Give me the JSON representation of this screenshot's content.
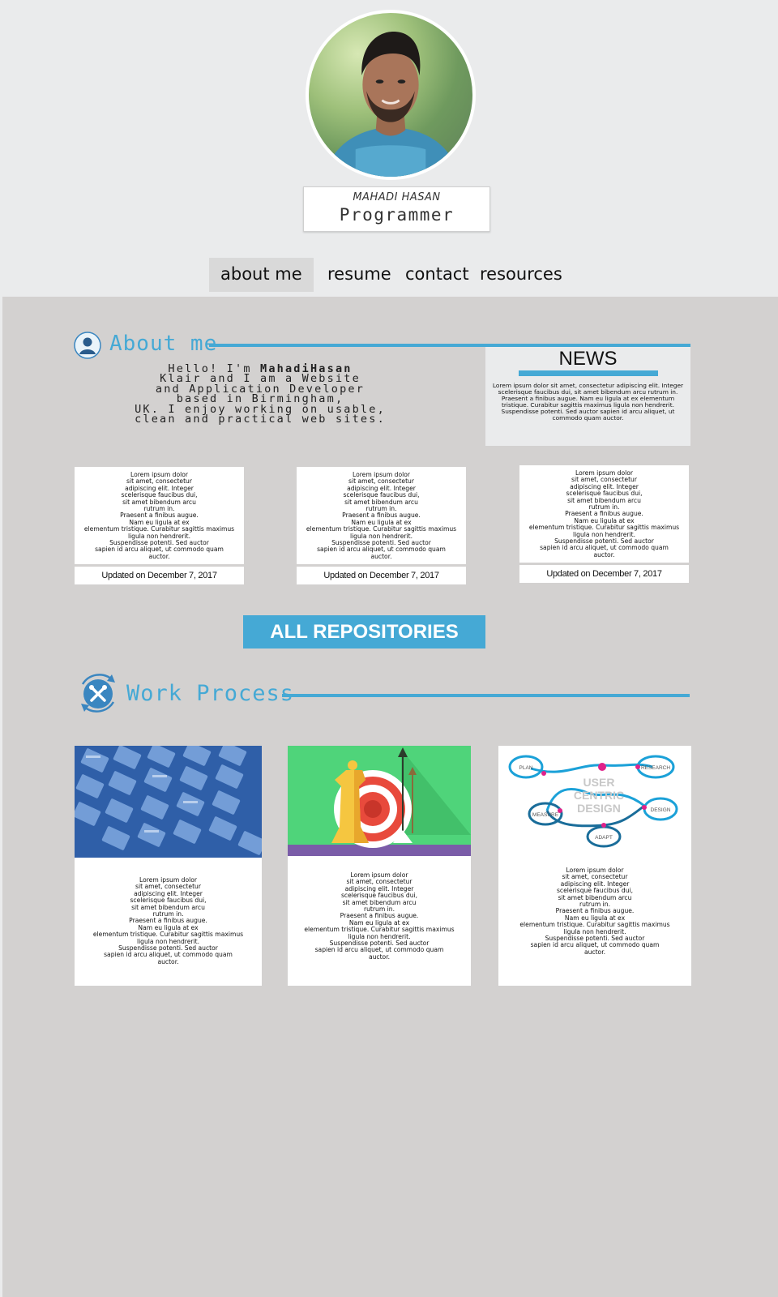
{
  "profile": {
    "name": "MAHADI HASAN",
    "role": "Programmer"
  },
  "nav": {
    "items": [
      {
        "label": "about me",
        "active": true
      },
      {
        "label": "resume",
        "active": false
      },
      {
        "label": "contact",
        "active": false
      },
      {
        "label": "resources",
        "active": false
      }
    ]
  },
  "about": {
    "title": "About me",
    "intro_before": "Hello! I'm ",
    "intro_name": "MahadiHasan",
    "intro_after": "\nKlair and I am a Website\nand Application Developer\nbased in Birmingham,\nUK. I enjoy working on usable,\nclean and practical web sites."
  },
  "news": {
    "title": "NEWS",
    "body": "Lorem ipsum dolor sit amet, consectetur adipiscing elit. Integer scelerisque faucibus dui, sit amet bibendum arcu rutrum in. Praesent a finibus augue. Nam eu ligula at ex elementum tristique. Curabitur sagittis maximus ligula non hendrerit. Suspendisse potenti. Sed auctor sapien id arcu aliquet, ut commodo quam auctor."
  },
  "repo_cards": [
    {
      "text": "Lorem ipsum dolor\nsit amet, consectetur\nadipiscing elit. Integer\nscelerisque faucibus dui,\nsit amet bibendum arcu\nrutrum in.\nPraesent a finibus augue.\nNam eu ligula at ex\nelementum tristique. Curabitur sagittis maximus\nligula non hendrerit.\nSuspendisse potenti. Sed auctor\nsapien id arcu aliquet, ut commodo quam\nauctor.",
      "updated": "Updated on December 7, 2017"
    },
    {
      "text": "Lorem ipsum dolor\nsit amet, consectetur\nadipiscing elit. Integer\nscelerisque faucibus dui,\nsit amet bibendum arcu\nrutrum in.\nPraesent a finibus augue.\nNam eu ligula at ex\nelementum tristique. Curabitur sagittis maximus\nligula non hendrerit.\nSuspendisse potenti. Sed auctor\nsapien id arcu aliquet, ut commodo quam\nauctor.",
      "updated": "Updated on December 7, 2017"
    },
    {
      "text": "Lorem ipsum dolor\nsit amet, consectetur\nadipiscing elit. Integer\nscelerisque faucibus dui,\nsit amet bibendum arcu\nrutrum in.\nPraesent a finibus augue.\nNam eu ligula at ex\nelementum tristique. Curabitur sagittis maximus\nligula non hendrerit.\nSuspendisse potenti. Sed auctor\nsapien id arcu aliquet, ut commodo quam\nauctor.",
      "updated": "Updated on December 7, 2017"
    }
  ],
  "all_repos_label": "ALL REPOSITORIES",
  "work": {
    "title": "Work Process",
    "cards": [
      {
        "image": "wireframe-grid",
        "text": "Lorem ipsum dolor\nsit amet, consectetur\nadipiscing elit. Integer\nscelerisque faucibus dui,\nsit amet bibendum arcu\nrutrum in.\nPraesent a finibus augue.\nNam eu ligula at ex\nelementum tristique. Curabitur sagittis maximus\nligula non hendrerit.\nSuspendisse potenti. Sed auctor\nsapien id arcu aliquet, ut commodo quam\nauctor."
      },
      {
        "image": "strategy-target",
        "text": "Lorem ipsum dolor\nsit amet, consectetur\nadipiscing elit. Integer\nscelerisque faucibus dui,\nsit amet bibendum arcu\nrutrum in.\nPraesent a finibus augue.\nNam eu ligula at ex\nelementum tristique. Curabitur sagittis maximus\nligula non hendrerit.\nSuspendisse potenti. Sed auctor\nsapien id arcu aliquet, ut commodo quam\nauctor."
      },
      {
        "image": "user-centric-design",
        "diagram_labels": {
          "center": [
            "USER",
            "CENTRIC",
            "DESIGN"
          ],
          "nodes": [
            "PLAN",
            "RESEARCH",
            "MEASURE",
            "DESIGN",
            "ADAPT"
          ]
        },
        "text": "Lorem ipsum dolor\nsit amet, consectetur\nadipiscing elit. Integer\nscelerisque faucibus dui,\nsit amet bibendum arcu\nrutrum in.\nPraesent a finibus augue.\nNam eu ligula at ex\nelementum tristique. Curabitur sagittis maximus\nligula non hendrerit.\nSuspendisse potenti. Sed auctor\nsapien id arcu aliquet, ut commodo quam\nauctor."
      }
    ]
  },
  "colors": {
    "accent": "#45a9d5",
    "header_bg": "#eaebec",
    "main_bg": "#d3d1d0"
  }
}
